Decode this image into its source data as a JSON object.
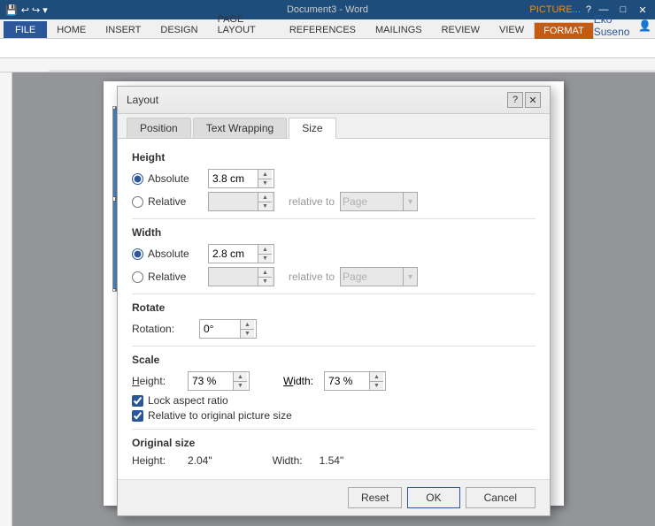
{
  "titlebar": {
    "doc_name": "Document3 - Word",
    "picture_tools": "PICTURE...",
    "help_btn": "?",
    "min_btn": "—",
    "max_btn": "□",
    "close_btn": "✕"
  },
  "ribbon": {
    "tabs": [
      "FILE",
      "HOME",
      "INSERT",
      "DESIGN",
      "PAGE LAYOUT",
      "REFERENCES",
      "MAILINGS",
      "REVIEW",
      "VIEW",
      "FORMAT"
    ],
    "user": "Eko Suseno"
  },
  "dialog": {
    "title": "Layout",
    "help_btn": "?",
    "close_btn": "✕",
    "tabs": [
      "Position",
      "Text Wrapping",
      "Size"
    ],
    "active_tab": "Size",
    "sections": {
      "height": {
        "label": "Height",
        "absolute_label": "Absolute",
        "absolute_value": "3.8 cm",
        "relative_label": "Relative",
        "relative_value": "",
        "relative_to_label": "relative to",
        "relative_to_value": "Page",
        "relative_disabled": true
      },
      "width": {
        "label": "Width",
        "absolute_label": "Absolute",
        "absolute_value": "2.8 cm",
        "relative_label": "Relative",
        "relative_value": "",
        "relative_to_label": "relative to",
        "relative_to_value": "Page",
        "relative_disabled": true
      },
      "rotate": {
        "label": "Rotate",
        "rotation_label": "Rotation:",
        "rotation_value": "0°"
      },
      "scale": {
        "label": "Scale",
        "height_label": "Height:",
        "height_value": "73 %",
        "width_label": "Width:",
        "width_value": "73 %",
        "lock_label": "Lock aspect ratio",
        "relative_label": "Relative to original picture size"
      },
      "original_size": {
        "label": "Original size",
        "height_label": "Height:",
        "height_value": "2.04\"",
        "width_label": "Width:",
        "width_value": "1.54\""
      }
    },
    "reset_btn": "Reset",
    "ok_btn": "OK",
    "cancel_btn": "Cancel"
  }
}
